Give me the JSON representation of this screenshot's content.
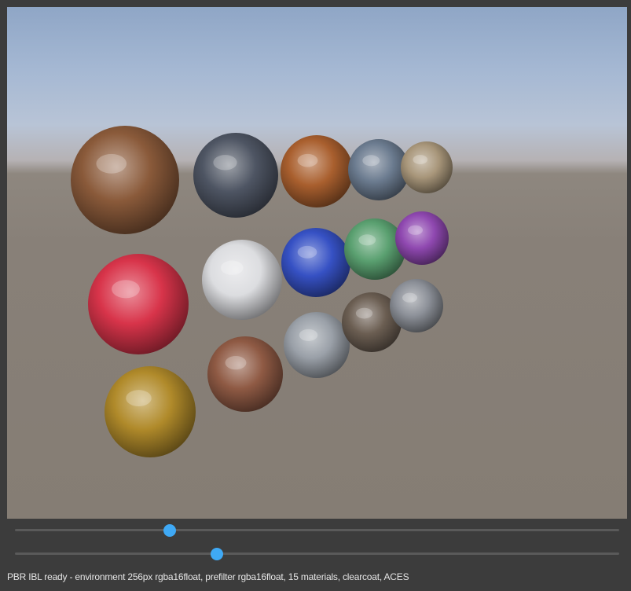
{
  "viewport": {
    "sky_top": "#8fa6c6",
    "ground": "#857d74"
  },
  "materials": [
    {
      "name": "wood-tan",
      "color": "#8a5a3a"
    },
    {
      "name": "slate-gray",
      "color": "#4e5563"
    },
    {
      "name": "copper-orange",
      "color": "#a95f2e"
    },
    {
      "name": "steel-blue-gray",
      "color": "#6b7b8f"
    },
    {
      "name": "sand-beige",
      "color": "#a8967a"
    },
    {
      "name": "red-glossy",
      "color": "#d8344a"
    },
    {
      "name": "white",
      "color": "#dcdde0"
    },
    {
      "name": "blue",
      "color": "#3651c4"
    },
    {
      "name": "green",
      "color": "#5aa070"
    },
    {
      "name": "purple",
      "color": "#8f48b0"
    },
    {
      "name": "gold-metal",
      "color": "#b08a2a"
    },
    {
      "name": "copper-metal",
      "color": "#8f5a44"
    },
    {
      "name": "chrome",
      "color": "#9aa0a8"
    },
    {
      "name": "dark-bronze",
      "color": "#6b5e52"
    },
    {
      "name": "silver",
      "color": "#8c9098"
    }
  ],
  "sliders": [
    {
      "name": "slider-1",
      "value": 0.256
    },
    {
      "name": "slider-2",
      "value": 0.334
    }
  ],
  "status": {
    "text": "PBR IBL ready - environment 256px rgba16float, prefilter rgba16float, 15 materials, clearcoat, ACES"
  }
}
